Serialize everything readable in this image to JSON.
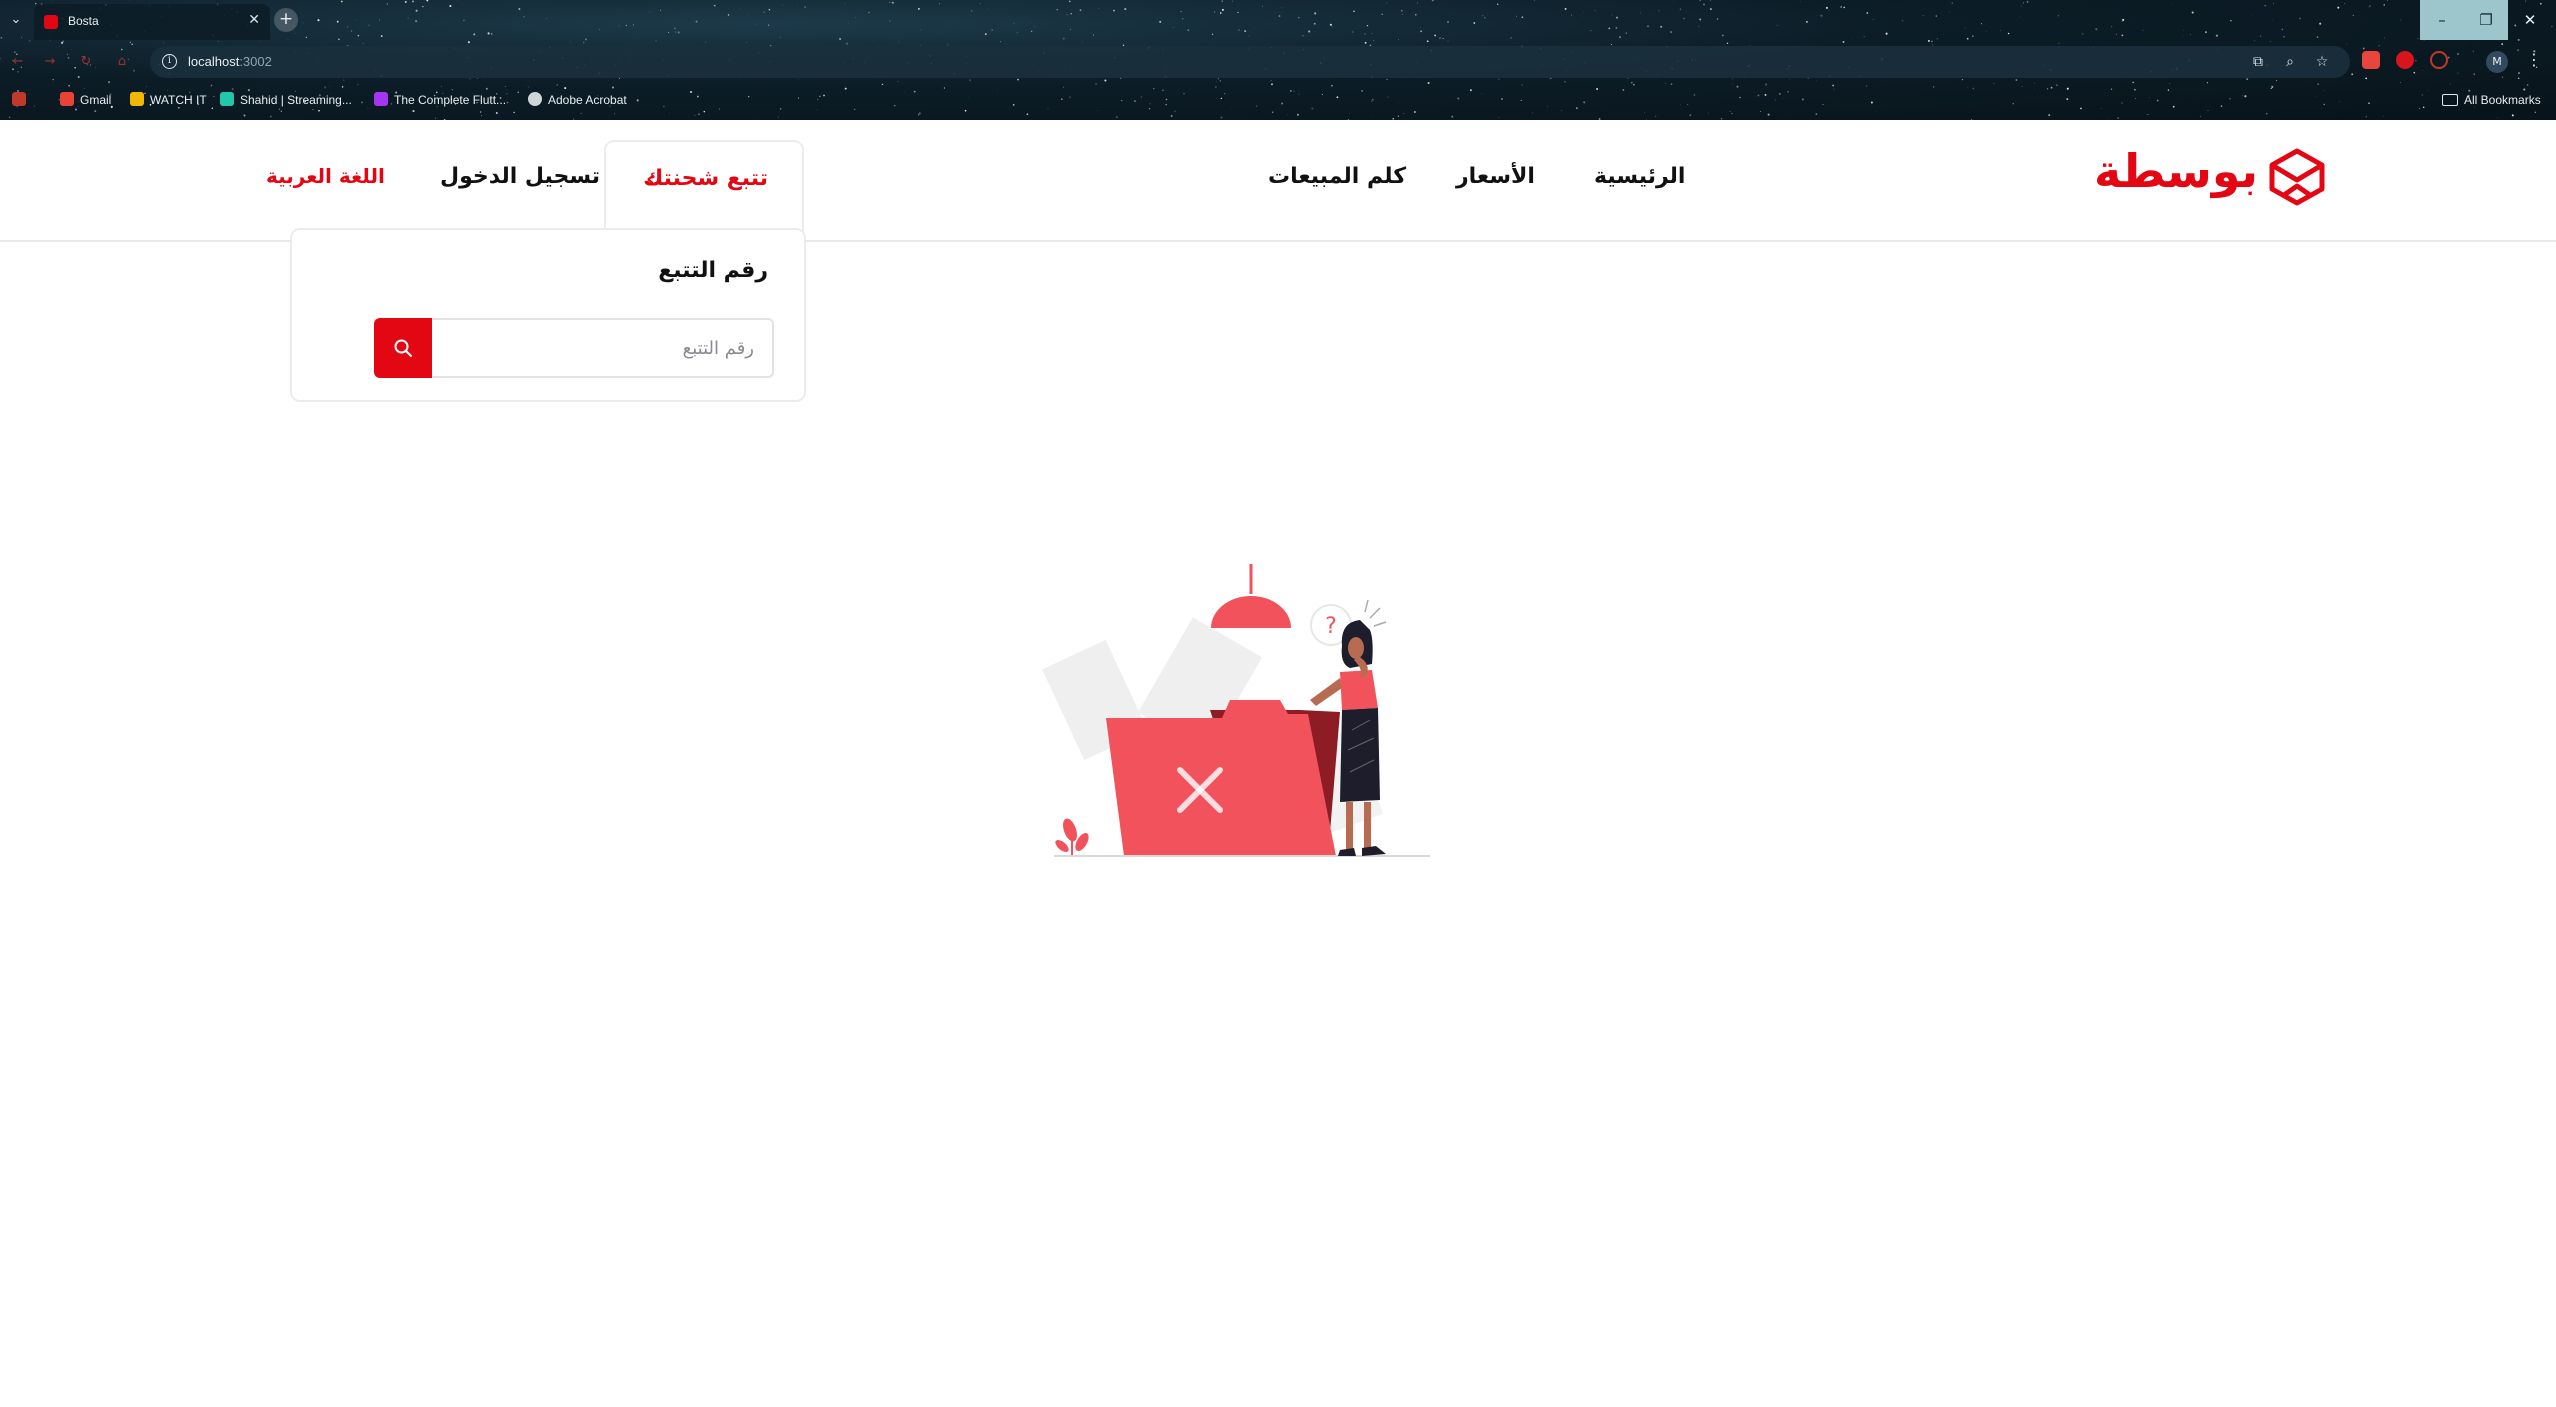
{
  "browser": {
    "tab_title": "Bosta",
    "url_host": "localhost",
    "url_port": ":3002",
    "profile_initial": "M",
    "bookmarks": [
      {
        "label": "Gmail",
        "color": "#ea4335"
      },
      {
        "label": "WATCH IT",
        "color": "#f2b705"
      },
      {
        "label": "Shahid | Streaming...",
        "color": "#21c7a8"
      },
      {
        "label": "The Complete Flutt...",
        "color": "#a435f0"
      },
      {
        "label": "Adobe Acrobat",
        "color": "#cfd6da"
      }
    ],
    "all_bookmarks_label": "All Bookmarks"
  },
  "header": {
    "logo_text": "بوسطة",
    "nav": {
      "home": "الرئيسية",
      "pricing": "الأسعار",
      "sales": "كلم المبيعات",
      "track": "تتبع شحنتك",
      "login": "تسجيل الدخول",
      "language": "اللغة العربية"
    }
  },
  "tracking": {
    "title": "رقم التتبع",
    "input_placeholder": "رقم التتبع",
    "input_value": ""
  },
  "colors": {
    "brand_red": "#e30613",
    "illustration_red": "#f2525c",
    "illustration_dark_red": "#8e1c24"
  },
  "icons": {
    "search": "search-icon",
    "chevron": "chevron-left-icon",
    "empty_state": "empty-folder-illustration"
  }
}
